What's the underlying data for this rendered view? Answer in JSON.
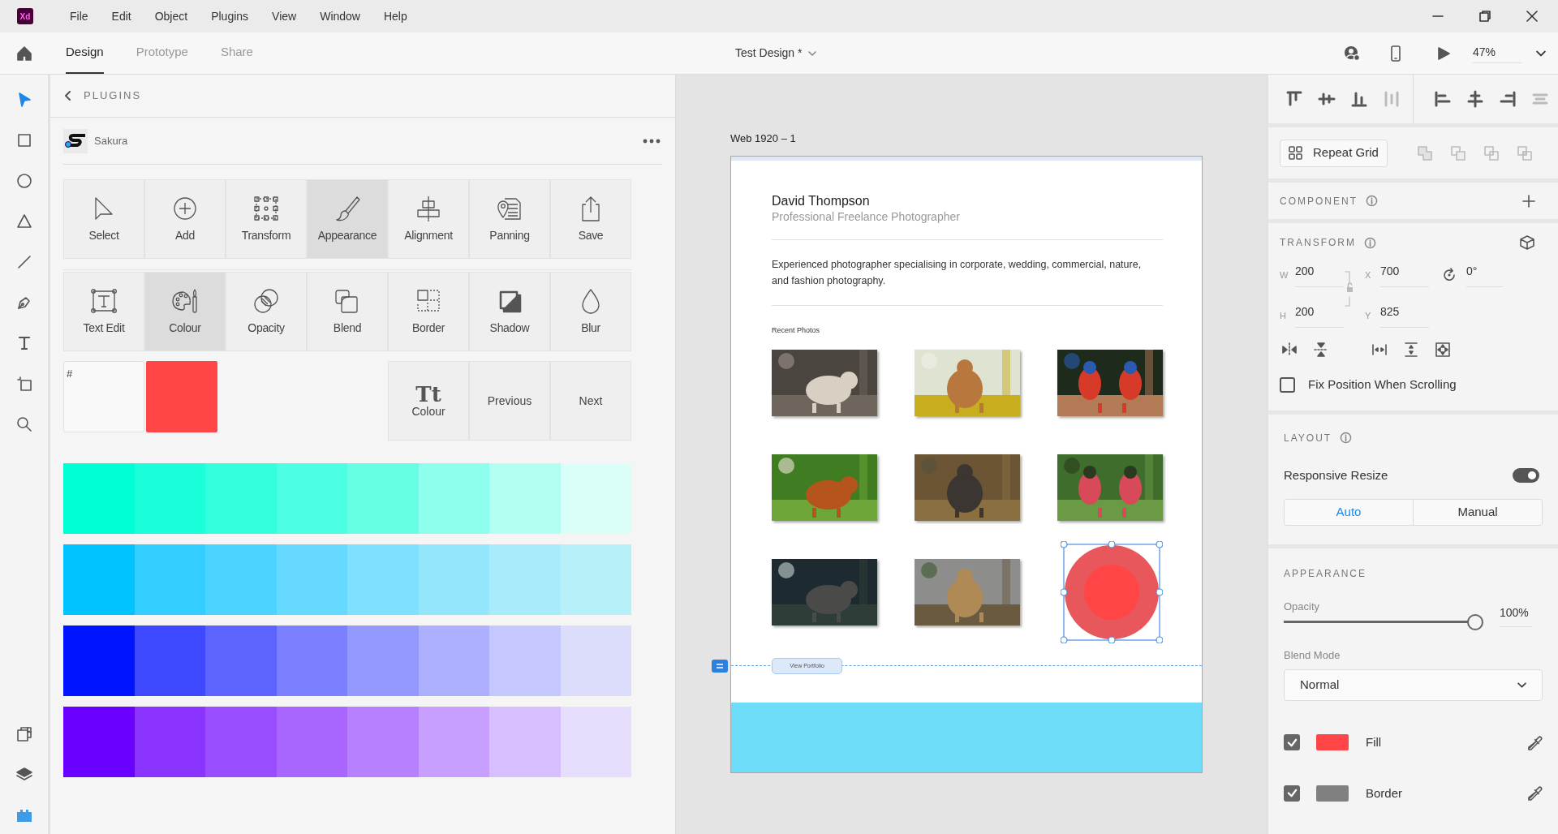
{
  "app_logo": "Xd",
  "menu": [
    "File",
    "Edit",
    "Object",
    "Plugins",
    "View",
    "Window",
    "Help"
  ],
  "mode_tabs": [
    {
      "label": "Design",
      "selected": true
    },
    {
      "label": "Prototype",
      "selected": false
    },
    {
      "label": "Share",
      "selected": false
    }
  ],
  "document_title": "Test Design *",
  "zoom": "47%",
  "tools": [
    {
      "selected": true
    },
    {
      "selected": false
    },
    {
      "selected": false
    },
    {
      "selected": false
    },
    {
      "selected": false
    },
    {
      "selected": false
    },
    {
      "selected": false
    },
    {
      "selected": false
    },
    {
      "selected": false
    }
  ],
  "panel_tools": [
    {
      "selected": false
    },
    {
      "selected": false
    },
    {
      "selected": true
    }
  ],
  "plugins_panel": {
    "heading": "PLUGINS",
    "plugin_name": "Sakura",
    "tool_rows": [
      [
        {
          "label": "Select",
          "selected": false
        },
        {
          "label": "Add",
          "selected": false
        },
        {
          "label": "Transform",
          "selected": false
        },
        {
          "label": "Appearance",
          "selected": true
        },
        {
          "label": "Alignment",
          "selected": false
        },
        {
          "label": "Panning",
          "selected": false
        },
        {
          "label": "Save",
          "selected": false
        }
      ],
      [
        {
          "label": "Text Edit",
          "selected": false
        },
        {
          "label": "Colour",
          "selected": true
        },
        {
          "label": "Opacity",
          "selected": false
        },
        {
          "label": "Blend",
          "selected": false
        },
        {
          "label": "Border",
          "selected": false
        },
        {
          "label": "Shadow",
          "selected": false
        },
        {
          "label": "Blur",
          "selected": false
        }
      ]
    ],
    "hex_field": {
      "value": "#"
    },
    "preview": {
      "color": "#ff4545"
    },
    "text_colour_button": {
      "glyph": "Tt",
      "label": "Colour"
    },
    "nav_buttons": [
      "Previous",
      "Next"
    ],
    "swatch_rows": [
      [
        {
          "color": "#00ffd5"
        },
        {
          "color": "#1affd9"
        },
        {
          "color": "#33ffdd"
        },
        {
          "color": "#4dffe2"
        },
        {
          "color": "#66ffe6"
        },
        {
          "color": "#8effec"
        },
        {
          "color": "#b3fff1"
        },
        {
          "color": "#dafff8"
        }
      ],
      [
        {
          "color": "#00c3ff"
        },
        {
          "color": "#33cdff"
        },
        {
          "color": "#4dd3ff"
        },
        {
          "color": "#66d9ff"
        },
        {
          "color": "#80e0ff"
        },
        {
          "color": "#94e6fd"
        },
        {
          "color": "#a8ecfb"
        },
        {
          "color": "#b8f0fa"
        }
      ],
      [
        {
          "color": "#0014ff"
        },
        {
          "color": "#3d48ff"
        },
        {
          "color": "#5c63ff"
        },
        {
          "color": "#7a80ff"
        },
        {
          "color": "#9499ff"
        },
        {
          "color": "#adb0ff"
        },
        {
          "color": "#c5c7ff"
        },
        {
          "color": "#dcdcfb"
        }
      ],
      [
        {
          "color": "#6a00ff"
        },
        {
          "color": "#8a33ff"
        },
        {
          "color": "#994dff"
        },
        {
          "color": "#a866ff"
        },
        {
          "color": "#b780ff"
        },
        {
          "color": "#c89fff"
        },
        {
          "color": "#d7bfff"
        },
        {
          "color": "#e6defc"
        }
      ]
    ]
  },
  "canvas": {
    "artboard_label": "Web 1920 – 1",
    "artboard": {
      "name": "David Thompson",
      "subtitle": "Professional Freelance Photographer",
      "description": "Experienced photographer specialising in corporate, wedding, commercial, nature, and fashion photography.",
      "section_label": "Recent Photos",
      "tiles": [
        {
          "kind": "picture",
          "selected": false
        },
        {
          "kind": "picture",
          "selected": false
        },
        {
          "kind": "picture",
          "selected": false
        },
        {
          "kind": "picture",
          "selected": false
        },
        {
          "kind": "picture",
          "selected": false
        },
        {
          "kind": "picture",
          "selected": false
        },
        {
          "kind": "picture",
          "selected": false
        },
        {
          "kind": "picture",
          "selected": false
        },
        {
          "kind": "circle",
          "selected": true
        }
      ],
      "button": "View Portfolio"
    }
  },
  "properties": {
    "repeat_grid": "Repeat Grid",
    "component": {
      "heading": "COMPONENT"
    },
    "transform": {
      "heading": "TRANSFORM",
      "fields": [
        {
          "label": "W",
          "value": "200"
        },
        {
          "label": "X",
          "value": "700"
        },
        {
          "label": "H",
          "value": "200"
        },
        {
          "label": "Y",
          "value": "825"
        }
      ],
      "rotation": "0°",
      "fix_position": {
        "label": "Fix Position When Scrolling",
        "checked": false
      }
    },
    "layout": {
      "heading": "LAYOUT",
      "responsive_resize": {
        "label": "Responsive Resize",
        "on": true
      },
      "modes": [
        {
          "label": "Auto",
          "selected": true
        },
        {
          "label": "Manual",
          "selected": false
        }
      ]
    },
    "appearance": {
      "heading": "APPEARANCE",
      "opacity": {
        "label": "Opacity",
        "level": 1,
        "reading": "100%"
      },
      "blend_mode": {
        "label": "Blend Mode",
        "value": "Normal"
      },
      "paints": [
        {
          "label": "Fill",
          "checked": true,
          "color": "#ff4545"
        },
        {
          "label": "Border",
          "checked": true,
          "color": "#808080"
        }
      ]
    }
  }
}
